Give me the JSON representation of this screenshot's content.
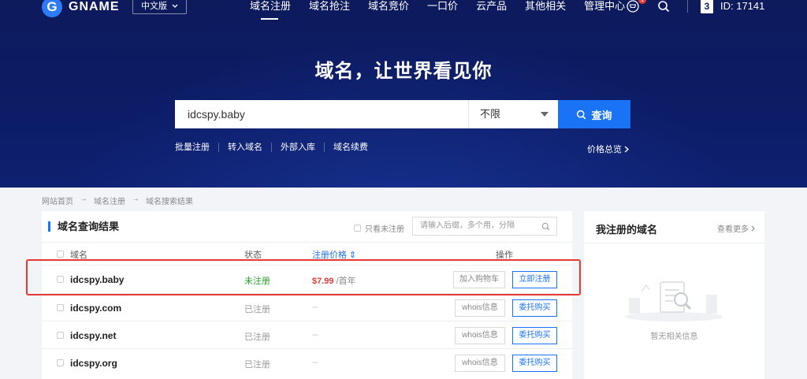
{
  "header": {
    "logo_text": "GNAME",
    "lang_label": "中文版",
    "nav": [
      "域名注册",
      "域名抢注",
      "域名竞价",
      "一口价",
      "云产品",
      "其他相关",
      "管理中心"
    ],
    "cart_badge": "1",
    "user_icon_label": "3",
    "user_id": "ID: 17141"
  },
  "hero": {
    "slogan": "域名，让世界看见你",
    "search_value": "idcspy.baby",
    "select_value": "不限",
    "search_button": "查询",
    "quick_links": [
      "批量注册",
      "转入域名",
      "外部入库",
      "域名续费"
    ],
    "price_overview": "价格总览"
  },
  "breadcrumb": [
    "网站首页",
    "域名注册",
    "域名搜索结果"
  ],
  "results": {
    "title": "域名查询结果",
    "only_unregistered": "只看未注册",
    "filter_placeholder": "请输入后缀，多个用，分隔",
    "columns": {
      "domain": "域名",
      "status": "状态",
      "price": "注册价格 ⇕",
      "action": "操作"
    },
    "rows": [
      {
        "domain": "idcspy.baby",
        "status": "未注册",
        "price": "$7.99",
        "price_unit": "/首年",
        "btn1": "加入购物车",
        "btn2": "立即注册"
      },
      {
        "domain": "idcspy.com",
        "status": "已注册",
        "price": "--",
        "price_unit": "",
        "btn1": "whois信息",
        "btn2": "委托购买"
      },
      {
        "domain": "idcspy.net",
        "status": "已注册",
        "price": "--",
        "price_unit": "",
        "btn1": "whois信息",
        "btn2": "委托购买"
      },
      {
        "domain": "idcspy.org",
        "status": "已注册",
        "price": "--",
        "price_unit": "",
        "btn1": "whois信息",
        "btn2": "委托购买"
      }
    ]
  },
  "side": {
    "title": "我注册的域名",
    "more": "查看更多",
    "empty_text": "暂无相关信息"
  },
  "colors": {
    "hero_bg": "#0c1c66",
    "accent": "#1a73f5",
    "success": "#2aa02a",
    "price": "#e53935",
    "highlight": "#e53935"
  }
}
